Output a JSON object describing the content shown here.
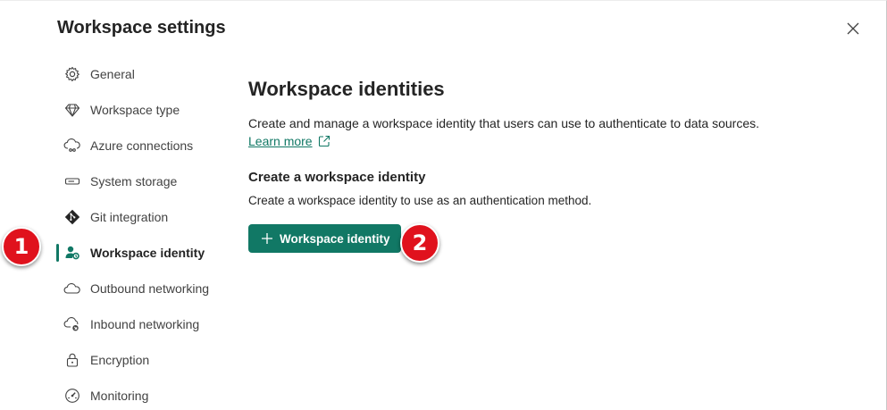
{
  "dialog": {
    "title": "Workspace settings",
    "close_icon": "close-icon"
  },
  "nav": {
    "items": [
      {
        "label": "General",
        "icon": "gear-icon"
      },
      {
        "label": "Workspace type",
        "icon": "diamond-icon"
      },
      {
        "label": "Azure connections",
        "icon": "cloud-link-icon"
      },
      {
        "label": "System storage",
        "icon": "storage-icon"
      },
      {
        "label": "Git integration",
        "icon": "git-icon"
      },
      {
        "label": "Workspace identity",
        "icon": "identity-icon",
        "selected": true
      },
      {
        "label": "Outbound networking",
        "icon": "cloud-outbound-icon"
      },
      {
        "label": "Inbound networking",
        "icon": "cloud-inbound-icon"
      },
      {
        "label": "Encryption",
        "icon": "lock-icon"
      },
      {
        "label": "Monitoring",
        "icon": "gauge-icon"
      }
    ]
  },
  "main": {
    "heading": "Workspace identities",
    "description": "Create and manage a workspace identity that users can use to authenticate to data sources.",
    "learn_more": "Learn more",
    "section_heading": "Create a workspace identity",
    "section_description": "Create a workspace identity to use as an authentication method.",
    "create_button": "Workspace identity"
  },
  "annotations": {
    "badge_1": "1",
    "badge_2": "2"
  },
  "colors": {
    "accent": "#117865",
    "badge": "#e0121d"
  }
}
